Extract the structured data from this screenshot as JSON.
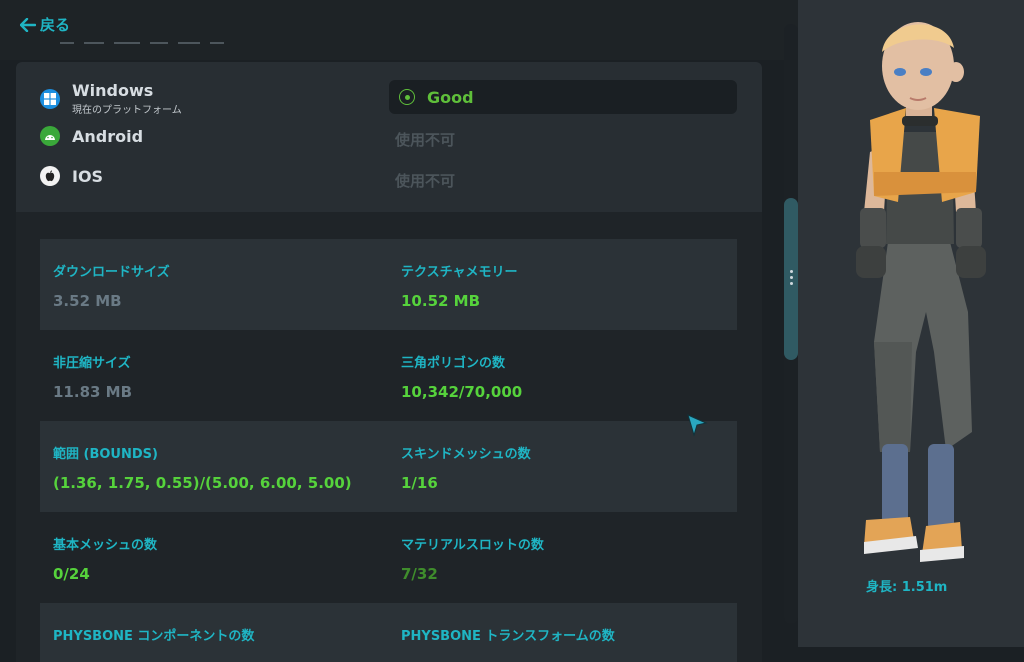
{
  "header": {
    "back_label": "戻る"
  },
  "platforms": [
    {
      "name": "Windows",
      "subtitle": "現在のプラットフォーム",
      "status": "Good",
      "icon": "windows-icon"
    },
    {
      "name": "Android",
      "subtitle": "",
      "status": "使用不可",
      "icon": "android-icon"
    },
    {
      "name": "IOS",
      "subtitle": "",
      "status": "使用不可",
      "icon": "apple-icon"
    }
  ],
  "stats": [
    {
      "left": {
        "label": "ダウンロードサイズ",
        "value": "3.52 MB"
      },
      "right": {
        "label": "テクスチャメモリー",
        "value": "10.52 MB"
      }
    },
    {
      "left": {
        "label": "非圧縮サイズ",
        "value": "11.83 MB"
      },
      "right": {
        "label": "三角ポリゴンの数",
        "value": "10,342/70,000"
      }
    },
    {
      "left": {
        "label": "範囲 (BOUNDS)",
        "value": "(1.36, 1.75, 0.55)/(5.00, 6.00, 5.00)"
      },
      "right": {
        "label": "スキンドメッシュの数",
        "value": "1/16"
      }
    },
    {
      "left": {
        "label": "基本メッシュの数",
        "value": "0/24"
      },
      "right": {
        "label": "マテリアルスロットの数",
        "value": "7/32"
      }
    },
    {
      "left": {
        "label": "PHYSBONE コンポーネントの数",
        "value": ""
      },
      "right": {
        "label": "PHYSBONE トランスフォームの数",
        "value": ""
      }
    }
  ],
  "preview": {
    "height_label": "身長: 1.51m"
  },
  "colors": {
    "accent": "#1fb5c4",
    "good": "#56d33c",
    "warning_green": "#3f8d2c",
    "muted": "#6a7a85"
  }
}
